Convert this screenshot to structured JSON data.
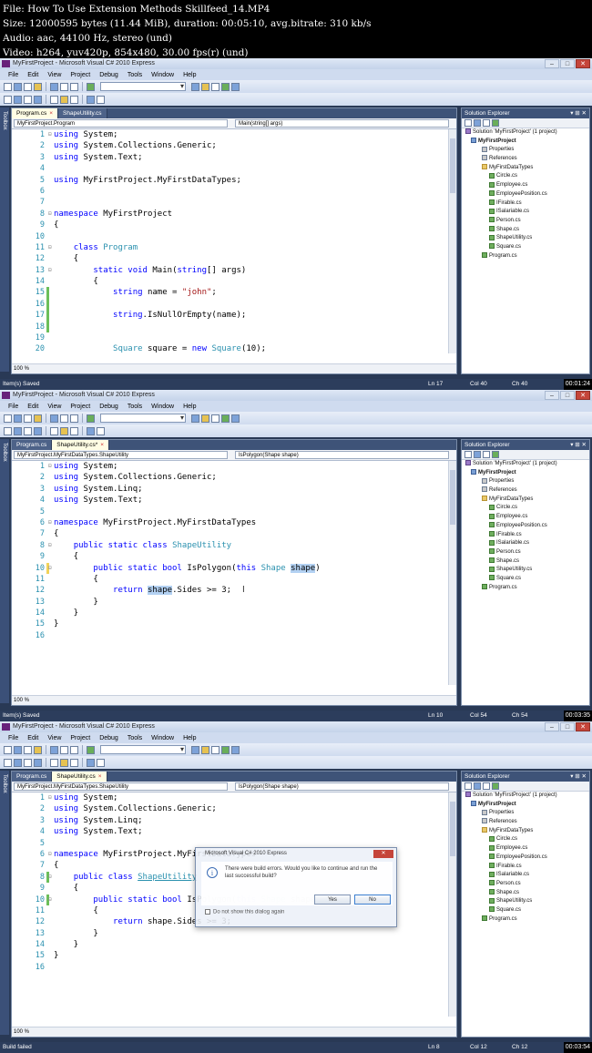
{
  "meta": [
    "File: How To Use Extension Methods Skillfeed_14.MP4",
    "Size: 12000595 bytes (11.44 MiB), duration: 00:05:10, avg.bitrate: 310 kb/s",
    "Audio: aac, 44100 Hz, stereo (und)",
    "Video: h264, yuv420p, 854x480, 30.00 fps(r) (und)"
  ],
  "app": {
    "title": "MyFirstProject - Microsoft Visual C# 2010 Express",
    "menus": [
      "File",
      "Edit",
      "View",
      "Project",
      "Debug",
      "Tools",
      "Window",
      "Help"
    ],
    "toolbox_label": "Toolbox",
    "zoom": "100 %"
  },
  "solution_explorer": {
    "title": "Solution Explorer",
    "items": [
      {
        "label": "Solution 'MyFirstProject' (1 project)",
        "icon": "sol"
      },
      {
        "label": "MyFirstProject",
        "icon": "proj"
      },
      {
        "label": "Properties",
        "icon": "prop"
      },
      {
        "label": "References",
        "icon": "prop"
      },
      {
        "label": "MyFirstDataTypes",
        "icon": "folder"
      },
      {
        "label": "Circle.cs",
        "icon": "cs"
      },
      {
        "label": "Employee.cs",
        "icon": "cs"
      },
      {
        "label": "EmployeePosition.cs",
        "icon": "cs"
      },
      {
        "label": "IFirable.cs",
        "icon": "cs"
      },
      {
        "label": "ISalariable.cs",
        "icon": "cs"
      },
      {
        "label": "Person.cs",
        "icon": "cs"
      },
      {
        "label": "Shape.cs",
        "icon": "cs"
      },
      {
        "label": "ShapeUtility.cs",
        "icon": "cs"
      },
      {
        "label": "Square.cs",
        "icon": "cs"
      },
      {
        "label": "Program.cs",
        "icon": "cs"
      }
    ]
  },
  "frames": [
    {
      "tabs": [
        {
          "label": "Program.cs",
          "active": true,
          "close": "×"
        },
        {
          "label": "ShapeUtility.cs",
          "active": false,
          "close": ""
        }
      ],
      "nav_left": "MyFirstProject.Program",
      "nav_right": "Main(string[] args)",
      "status_text": "Item(s) Saved",
      "ln": "Ln 17",
      "col": "Col 40",
      "ch": "Ch 40",
      "timestamp": "00:01:24",
      "lines": [
        {
          "n": "1",
          "fold": "⊟",
          "chg": "",
          "segs": [
            [
              "kw",
              "using"
            ],
            [
              "",
              "System;"
            ]
          ]
        },
        {
          "n": "2",
          "fold": "",
          "chg": "",
          "segs": [
            [
              "kw",
              "using"
            ],
            [
              "",
              "System.Collections.Generic;"
            ]
          ]
        },
        {
          "n": "3",
          "fold": "",
          "chg": "",
          "segs": [
            [
              "kw",
              "using"
            ],
            [
              "",
              "System.Text;"
            ]
          ]
        },
        {
          "n": "4",
          "fold": "",
          "chg": "",
          "segs": []
        },
        {
          "n": "5",
          "fold": "",
          "chg": "",
          "segs": [
            [
              "kw",
              "using"
            ],
            [
              "",
              "MyFirstProject.MyFirstDataTypes;"
            ]
          ]
        },
        {
          "n": "6",
          "fold": "",
          "chg": "",
          "segs": []
        },
        {
          "n": "7",
          "fold": "",
          "chg": "",
          "segs": []
        },
        {
          "n": "8",
          "fold": "⊟",
          "chg": "",
          "segs": [
            [
              "kw",
              "namespace"
            ],
            [
              "",
              "MyFirstProject"
            ]
          ]
        },
        {
          "n": "9",
          "fold": "",
          "chg": "",
          "segs": [
            [
              "",
              "{"
            ]
          ]
        },
        {
          "n": "10",
          "fold": "",
          "chg": "",
          "segs": []
        },
        {
          "n": "11",
          "fold": "⊟",
          "chg": "",
          "segs": [
            [
              "",
              "    "
            ],
            [
              "kw",
              "class"
            ],
            [
              "ty",
              "Program"
            ]
          ]
        },
        {
          "n": "12",
          "fold": "",
          "chg": "",
          "segs": [
            [
              "",
              "    {"
            ]
          ]
        },
        {
          "n": "13",
          "fold": "⊟",
          "chg": "",
          "segs": [
            [
              "",
              "        "
            ],
            [
              "kw",
              "static void"
            ],
            [
              "",
              "Main("
            ],
            [
              "kw",
              "string"
            ],
            [
              "",
              "[] args)"
            ]
          ]
        },
        {
          "n": "14",
          "fold": "",
          "chg": "",
          "segs": [
            [
              "",
              "        {"
            ]
          ]
        },
        {
          "n": "15",
          "fold": "",
          "chg": "green",
          "segs": [
            [
              "",
              "            "
            ],
            [
              "kw",
              "string"
            ],
            [
              "",
              "name = "
            ],
            [
              "st",
              "\"john\""
            ],
            [
              "",
              ";"
            ]
          ]
        },
        {
          "n": "16",
          "fold": "",
          "chg": "green",
          "segs": []
        },
        {
          "n": "17",
          "fold": "",
          "chg": "green",
          "segs": [
            [
              "",
              "            "
            ],
            [
              "kw",
              "string"
            ],
            [
              "",
              ".IsNullOrEmpty(name);"
            ]
          ]
        },
        {
          "n": "18",
          "fold": "",
          "chg": "green",
          "segs": []
        },
        {
          "n": "19",
          "fold": "",
          "chg": "",
          "segs": []
        },
        {
          "n": "20",
          "fold": "",
          "chg": "",
          "segs": [
            [
              "",
              "            "
            ],
            [
              "ty",
              "Square"
            ],
            [
              "",
              "square = "
            ],
            [
              "kw",
              "new"
            ],
            [
              "ty",
              "Square"
            ],
            [
              "",
              "(10);"
            ]
          ]
        },
        {
          "n": "21",
          "fold": "",
          "chg": "",
          "segs": [
            [
              "",
              "            "
            ],
            [
              "ty",
              "Circle"
            ],
            [
              "",
              "circle = "
            ],
            [
              "kw",
              "new"
            ],
            [
              "ty",
              "Circle"
            ],
            [
              "",
              "(10);"
            ]
          ]
        }
      ]
    },
    {
      "tabs": [
        {
          "label": "Program.cs",
          "active": false,
          "close": ""
        },
        {
          "label": "ShapeUtility.cs*",
          "active": true,
          "close": "×"
        }
      ],
      "nav_left": "MyFirstProject.MyFirstDataTypes.ShapeUtility",
      "nav_right": "IsPolygon(Shape shape)",
      "status_text": "Item(s) Saved",
      "ln": "Ln 10",
      "col": "Col 54",
      "ch": "Ch 54",
      "timestamp": "00:03:35",
      "lines": [
        {
          "n": "1",
          "fold": "⊟",
          "chg": "",
          "segs": [
            [
              "kw",
              "using"
            ],
            [
              "",
              "System;"
            ]
          ]
        },
        {
          "n": "2",
          "fold": "",
          "chg": "",
          "segs": [
            [
              "kw",
              "using"
            ],
            [
              "",
              "System.Collections.Generic;"
            ]
          ]
        },
        {
          "n": "3",
          "fold": "",
          "chg": "",
          "segs": [
            [
              "kw",
              "using"
            ],
            [
              "",
              "System.Linq;"
            ]
          ]
        },
        {
          "n": "4",
          "fold": "",
          "chg": "",
          "segs": [
            [
              "kw",
              "using"
            ],
            [
              "",
              "System.Text;"
            ]
          ]
        },
        {
          "n": "5",
          "fold": "",
          "chg": "",
          "segs": []
        },
        {
          "n": "6",
          "fold": "⊟",
          "chg": "",
          "segs": [
            [
              "kw",
              "namespace"
            ],
            [
              "",
              "MyFirstProject.MyFirstDataTypes"
            ]
          ]
        },
        {
          "n": "7",
          "fold": "",
          "chg": "",
          "segs": [
            [
              "",
              "{"
            ]
          ]
        },
        {
          "n": "8",
          "fold": "⊟",
          "chg": "",
          "segs": [
            [
              "",
              "    "
            ],
            [
              "kw",
              "public static class"
            ],
            [
              "ty",
              "ShapeUtility"
            ]
          ]
        },
        {
          "n": "9",
          "fold": "",
          "chg": "",
          "segs": [
            [
              "",
              "    {"
            ]
          ]
        },
        {
          "n": "10",
          "fold": "⊟",
          "chg": "yellow",
          "segs": [
            [
              "",
              "        "
            ],
            [
              "kw",
              "public static bool"
            ],
            [
              "",
              "IsPolygon("
            ],
            [
              "kw",
              "this"
            ],
            [
              "ty",
              "Shape"
            ],
            [
              "sel",
              "shape"
            ],
            [
              "",
              ")"
            ]
          ]
        },
        {
          "n": "11",
          "fold": "",
          "chg": "",
          "segs": [
            [
              "",
              "        {"
            ]
          ]
        },
        {
          "n": "12",
          "fold": "",
          "chg": "",
          "segs": [
            [
              "",
              "            "
            ],
            [
              "kw",
              "return"
            ],
            [
              "sel",
              "shape"
            ],
            [
              "",
              ".Sides >= 3;"
            ]
          ]
        },
        {
          "n": "13",
          "fold": "",
          "chg": "",
          "segs": [
            [
              "",
              "        }"
            ]
          ]
        },
        {
          "n": "14",
          "fold": "",
          "chg": "",
          "segs": [
            [
              "",
              "    }"
            ]
          ]
        },
        {
          "n": "15",
          "fold": "",
          "chg": "",
          "segs": [
            [
              "",
              "}"
            ]
          ]
        },
        {
          "n": "16",
          "fold": "",
          "chg": "",
          "segs": []
        }
      ]
    },
    {
      "tabs": [
        {
          "label": "Program.cs",
          "active": false,
          "close": ""
        },
        {
          "label": "ShapeUtility.cs",
          "active": true,
          "close": "×"
        }
      ],
      "nav_left": "MyFirstProject.MyFirstDataTypes.ShapeUtility",
      "nav_right": "IsPolygon(Shape shape)",
      "status_text": "Build failed",
      "ln": "Ln 8",
      "col": "Col 12",
      "ch": "Ch 12",
      "timestamp": "00:03:54",
      "dialog": {
        "title": "Microsoft Visual C# 2010 Express",
        "message": "There were build errors. Would you like to continue and run the last successful build?",
        "yes": "Yes",
        "no": "No",
        "checkbox": "Do not show this dialog again"
      },
      "lines": [
        {
          "n": "1",
          "fold": "⊟",
          "chg": "",
          "segs": [
            [
              "kw",
              "using"
            ],
            [
              "",
              "System;"
            ]
          ]
        },
        {
          "n": "2",
          "fold": "",
          "chg": "",
          "segs": [
            [
              "kw",
              "using"
            ],
            [
              "",
              "System.Collections.Generic;"
            ]
          ]
        },
        {
          "n": "3",
          "fold": "",
          "chg": "",
          "segs": [
            [
              "kw",
              "using"
            ],
            [
              "",
              "System.Linq;"
            ]
          ]
        },
        {
          "n": "4",
          "fold": "",
          "chg": "",
          "segs": [
            [
              "kw",
              "using"
            ],
            [
              "",
              "System.Text;"
            ]
          ]
        },
        {
          "n": "5",
          "fold": "",
          "chg": "",
          "segs": []
        },
        {
          "n": "6",
          "fold": "⊟",
          "chg": "",
          "segs": [
            [
              "kw",
              "namespace"
            ],
            [
              "",
              "MyFirstProject.MyFirstDataTypes"
            ]
          ]
        },
        {
          "n": "7",
          "fold": "",
          "chg": "",
          "segs": [
            [
              "",
              "{"
            ]
          ]
        },
        {
          "n": "8",
          "fold": "⊟",
          "chg": "green",
          "segs": [
            [
              "",
              "    "
            ],
            [
              "kw",
              "public class"
            ],
            [
              "ty ul",
              "ShapeUtility"
            ]
          ]
        },
        {
          "n": "9",
          "fold": "",
          "chg": "",
          "segs": [
            [
              "",
              "    {"
            ]
          ]
        },
        {
          "n": "10",
          "fold": "⊟",
          "chg": "green",
          "segs": [
            [
              "",
              "        "
            ],
            [
              "kw",
              "public static bool"
            ],
            [
              "",
              "IsPolygon("
            ],
            [
              "kw",
              "this"
            ],
            [
              "ty",
              "Shape"
            ],
            [
              "",
              "shape)"
            ]
          ]
        },
        {
          "n": "11",
          "fold": "",
          "chg": "",
          "segs": [
            [
              "",
              "        {"
            ]
          ]
        },
        {
          "n": "12",
          "fold": "",
          "chg": "",
          "segs": [
            [
              "",
              "            "
            ],
            [
              "kw",
              "return"
            ],
            [
              "",
              "shape.Sides >= 3;"
            ]
          ]
        },
        {
          "n": "13",
          "fold": "",
          "chg": "",
          "segs": [
            [
              "",
              "        }"
            ]
          ]
        },
        {
          "n": "14",
          "fold": "",
          "chg": "",
          "segs": [
            [
              "",
              "    }"
            ]
          ]
        },
        {
          "n": "15",
          "fold": "",
          "chg": "",
          "segs": [
            [
              "",
              "}"
            ]
          ]
        },
        {
          "n": "16",
          "fold": "",
          "chg": "",
          "segs": []
        }
      ]
    }
  ]
}
